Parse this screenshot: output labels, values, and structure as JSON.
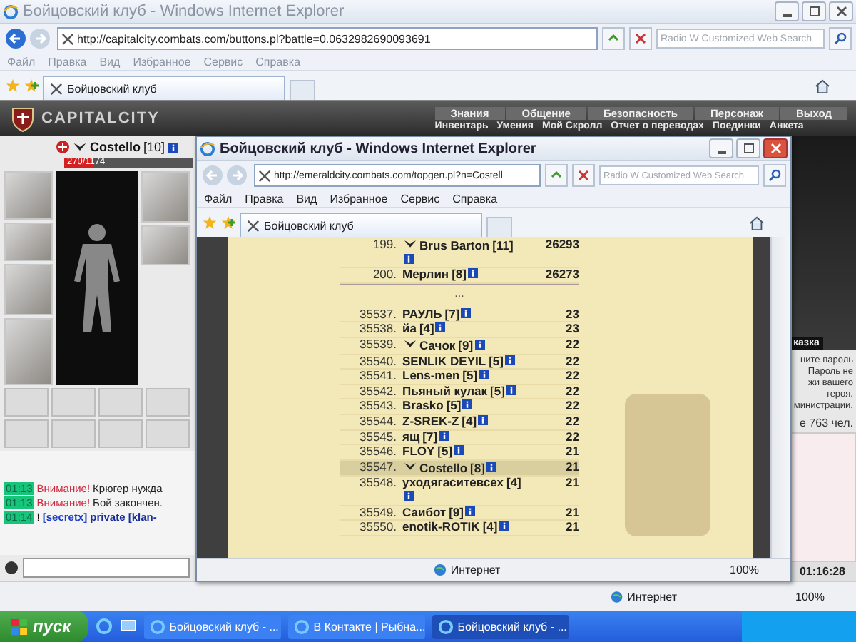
{
  "browser": {
    "title": "Бойцовский клуб - Windows Internet Explorer",
    "address": "http://capitalcity.combats.com/buttons.pl?battle=0.0632982690093691",
    "search_placeholder": "Radio W Customized Web Search",
    "menu": [
      "Файл",
      "Правка",
      "Вид",
      "Избранное",
      "Сервис",
      "Справка"
    ],
    "tab": "Бойцовский клуб",
    "status_zone": "Интернет",
    "zoom": "100%"
  },
  "game": {
    "logo": "CAPITALCITY",
    "nav_top": [
      "Знания",
      "Общение",
      "Безопасность",
      "Персонаж",
      "Выход"
    ],
    "nav_bottom": [
      "Инвентарь",
      "Умения",
      "Мой Скролл",
      "Отчет о переводах",
      "Поединки",
      "Анкета"
    ],
    "character": {
      "name": "Costello",
      "level": "[10]",
      "health": {
        "reading": "270/1174",
        "level": 0.23
      }
    },
    "chat": [
      {
        "time": "01:13",
        "kind": "alert",
        "label": "Внимание!",
        "text": "Крюгер нужда"
      },
      {
        "time": "01:13",
        "kind": "alert",
        "label": "Внимание!",
        "text": "Бой закончен."
      },
      {
        "time": "01:14",
        "kind": "private",
        "label": "!",
        "sender": "[secretx]",
        "text": "private [klan-"
      }
    ],
    "side": {
      "banner": "казка",
      "lines": [
        "ните пароль",
        "Пароль не",
        "жи вашего",
        "героя.",
        "министрации."
      ],
      "online": "е 763 чел.",
      "clock": "01:16:28"
    }
  },
  "popup": {
    "title": "Бойцовский клуб - Windows Internet Explorer",
    "address": "http://emeraldcity.combats.com/topgen.pl?n=Costell",
    "search_placeholder": "Radio W Customized Web Search",
    "menu": [
      "Файл",
      "Правка",
      "Вид",
      "Избранное",
      "Сервис",
      "Справка"
    ],
    "tab": "Бойцовский клуб",
    "status_zone": "Интернет",
    "zoom": "100%",
    "top_rows": [
      {
        "rank": "199.",
        "name": "Brus Barton",
        "level": "[11]",
        "score": "26293",
        "emblem": true,
        "selected": false
      },
      {
        "rank": "200.",
        "name": "Мерлин",
        "level": "[8]",
        "score": "26273",
        "emblem": false,
        "selected": false
      }
    ],
    "gap": "...",
    "rows": [
      {
        "rank": "35537.",
        "name": "РАУЛЬ",
        "level": "[7]",
        "score": "23",
        "emblem": false,
        "selected": false
      },
      {
        "rank": "35538.",
        "name": "йа",
        "level": "[4]",
        "score": "23",
        "emblem": false,
        "selected": false
      },
      {
        "rank": "35539.",
        "name": "Сачок",
        "level": "[9]",
        "score": "22",
        "emblem": true,
        "selected": false
      },
      {
        "rank": "35540.",
        "name": "SENLIK DEYIL",
        "level": "[5]",
        "score": "22",
        "emblem": false,
        "selected": false
      },
      {
        "rank": "35541.",
        "name": "Lens-men",
        "level": "[5]",
        "score": "22",
        "emblem": false,
        "selected": false
      },
      {
        "rank": "35542.",
        "name": "Пьяный кулак",
        "level": "[5]",
        "score": "22",
        "emblem": false,
        "selected": false
      },
      {
        "rank": "35543.",
        "name": "Brasko",
        "level": "[5]",
        "score": "22",
        "emblem": false,
        "selected": false
      },
      {
        "rank": "35544.",
        "name": "Z-SREK-Z",
        "level": "[4]",
        "score": "22",
        "emblem": false,
        "selected": false
      },
      {
        "rank": "35545.",
        "name": "ящ",
        "level": "[7]",
        "score": "22",
        "emblem": false,
        "selected": false
      },
      {
        "rank": "35546.",
        "name": "FLOY",
        "level": "[5]",
        "score": "21",
        "emblem": false,
        "selected": false
      },
      {
        "rank": "35547.",
        "name": "Costello",
        "level": "[8]",
        "score": "21",
        "emblem": true,
        "selected": true
      },
      {
        "rank": "35548.",
        "name": "уходягаситевсех",
        "level": "[4]",
        "score": "21",
        "emblem": false,
        "selected": false
      },
      {
        "rank": "35549.",
        "name": "Саибот",
        "level": "[9]",
        "score": "21",
        "emblem": false,
        "selected": false
      },
      {
        "rank": "35550.",
        "name": "enotik-ROTIK",
        "level": "[4]",
        "score": "21",
        "emblem": false,
        "selected": false
      }
    ]
  },
  "taskbar": {
    "start": "пуск",
    "tasks": [
      {
        "label": "Бойцовский клуб - ...",
        "selected": false
      },
      {
        "label": "В Контакте | Рыбна...",
        "selected": false
      },
      {
        "label": "Бойцовский клуб - ...",
        "selected": true
      }
    ]
  }
}
